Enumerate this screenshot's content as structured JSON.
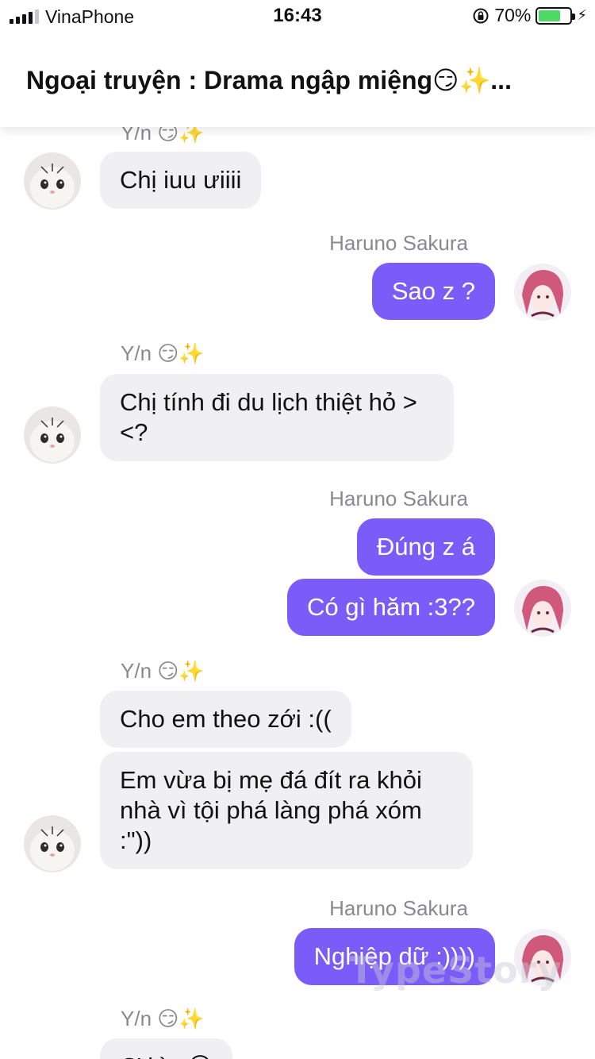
{
  "status_bar": {
    "carrier": "VinaPhone",
    "time": "16:43",
    "battery_percent": "70%",
    "battery_level": 0.7,
    "signal_bars": 4
  },
  "header": {
    "title": "Ngoại truyện : Drama ngập miệng😏✨..."
  },
  "chat": {
    "sender_yn": "Y/n 😏✨",
    "sender_sakura": "Haruno Sakura",
    "messages": [
      {
        "from": "yn",
        "text": "Chị iuu ưiiii"
      },
      {
        "from": "sakura",
        "text": "Sao z ?"
      },
      {
        "from": "yn",
        "text": "Chị tính đi du lịch thiệt hỏ ><?"
      },
      {
        "from": "sakura",
        "text": "Đúng z á"
      },
      {
        "from": "sakura",
        "text": "Có gì hăm :3??"
      },
      {
        "from": "yn",
        "text": "Cho em theo zới :(("
      },
      {
        "from": "yn",
        "text": "Em vừa bị mẹ đá đít ra khỏi nhà vì tội phá làng phá xóm :\"))"
      },
      {
        "from": "sakura",
        "text": "Nghiệp dữ :))))"
      },
      {
        "from": "yn",
        "text": "Ơ kìa 😏"
      }
    ]
  },
  "watermark": "TypeStory",
  "colors": {
    "outgoing_bubble": "#7c5cf8",
    "incoming_bubble": "#f0f0f2",
    "sender_name": "#8a8a8e",
    "battery_fill": "#4cd964"
  }
}
